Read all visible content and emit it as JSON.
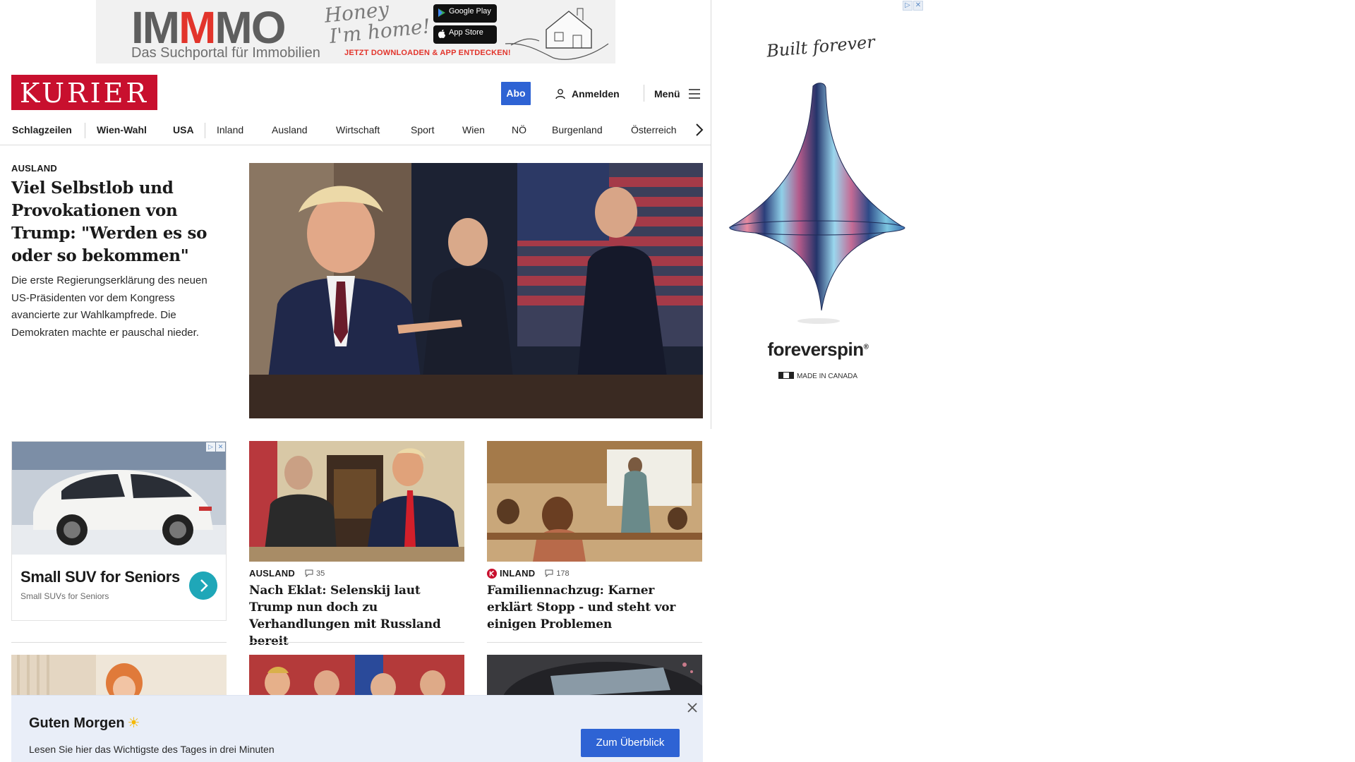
{
  "top_ad": {
    "brand_prefix": "IM",
    "brand_m": "M",
    "brand_suffix": "MO",
    "tagline": "Das Suchportal für Immobilien",
    "script_text_1": "Honey",
    "script_text_2": "I'm home!",
    "google_play": "Google Play",
    "app_store": "App Store",
    "cta": "JETZT DOWNLOADEN & APP ENTDECKEN!"
  },
  "side_ad": {
    "script_text": "Built forever",
    "brand": "foreverspin",
    "made_in": "MADE IN CANADA"
  },
  "header": {
    "logo": "KURIER",
    "abo_label": "Abo",
    "login_label": "Anmelden",
    "menu_label": "Menü"
  },
  "nav": {
    "items": [
      "Schlagzeilen",
      "Wien-Wahl",
      "USA",
      "Inland",
      "Ausland",
      "Wirtschaft",
      "Sport",
      "Wien",
      "NÖ",
      "Burgenland",
      "Österreich"
    ]
  },
  "lead": {
    "kicker": "AUSLAND",
    "title": "Viel Selbstlob und Provokationen von Trump: \"Werden es so oder so bekommen\"",
    "teaser": "Die erste Regierungserklärung des neuen US-Präsidenten vor dem Kongress avancierte zur Wahlkampfrede. Die Demokraten machte er pauschal nieder."
  },
  "sponsored": {
    "title": "Small SUV for Seniors",
    "subtitle": "Small SUVs for Seniors"
  },
  "cards": [
    {
      "kicker": "AUSLAND",
      "comments": "35",
      "title": "Nach Eklat: Selenskij laut Trump nun doch zu Verhandlungen mit Russland bereit"
    },
    {
      "kicker": "INLAND",
      "comments": "178",
      "premium": true,
      "title": "Familiennachzug: Karner erklärt Stopp - und steht vor einigen Problemen"
    }
  ],
  "notice": {
    "title": "Guten Morgen",
    "text": "Lesen Sie hier das Wichtigste des Tages in drei Minuten",
    "cta": "Zum Überblick"
  },
  "colors": {
    "brand_red": "#c8102e",
    "accent_blue": "#2e63d4",
    "notice_bg": "#e9eef8"
  }
}
